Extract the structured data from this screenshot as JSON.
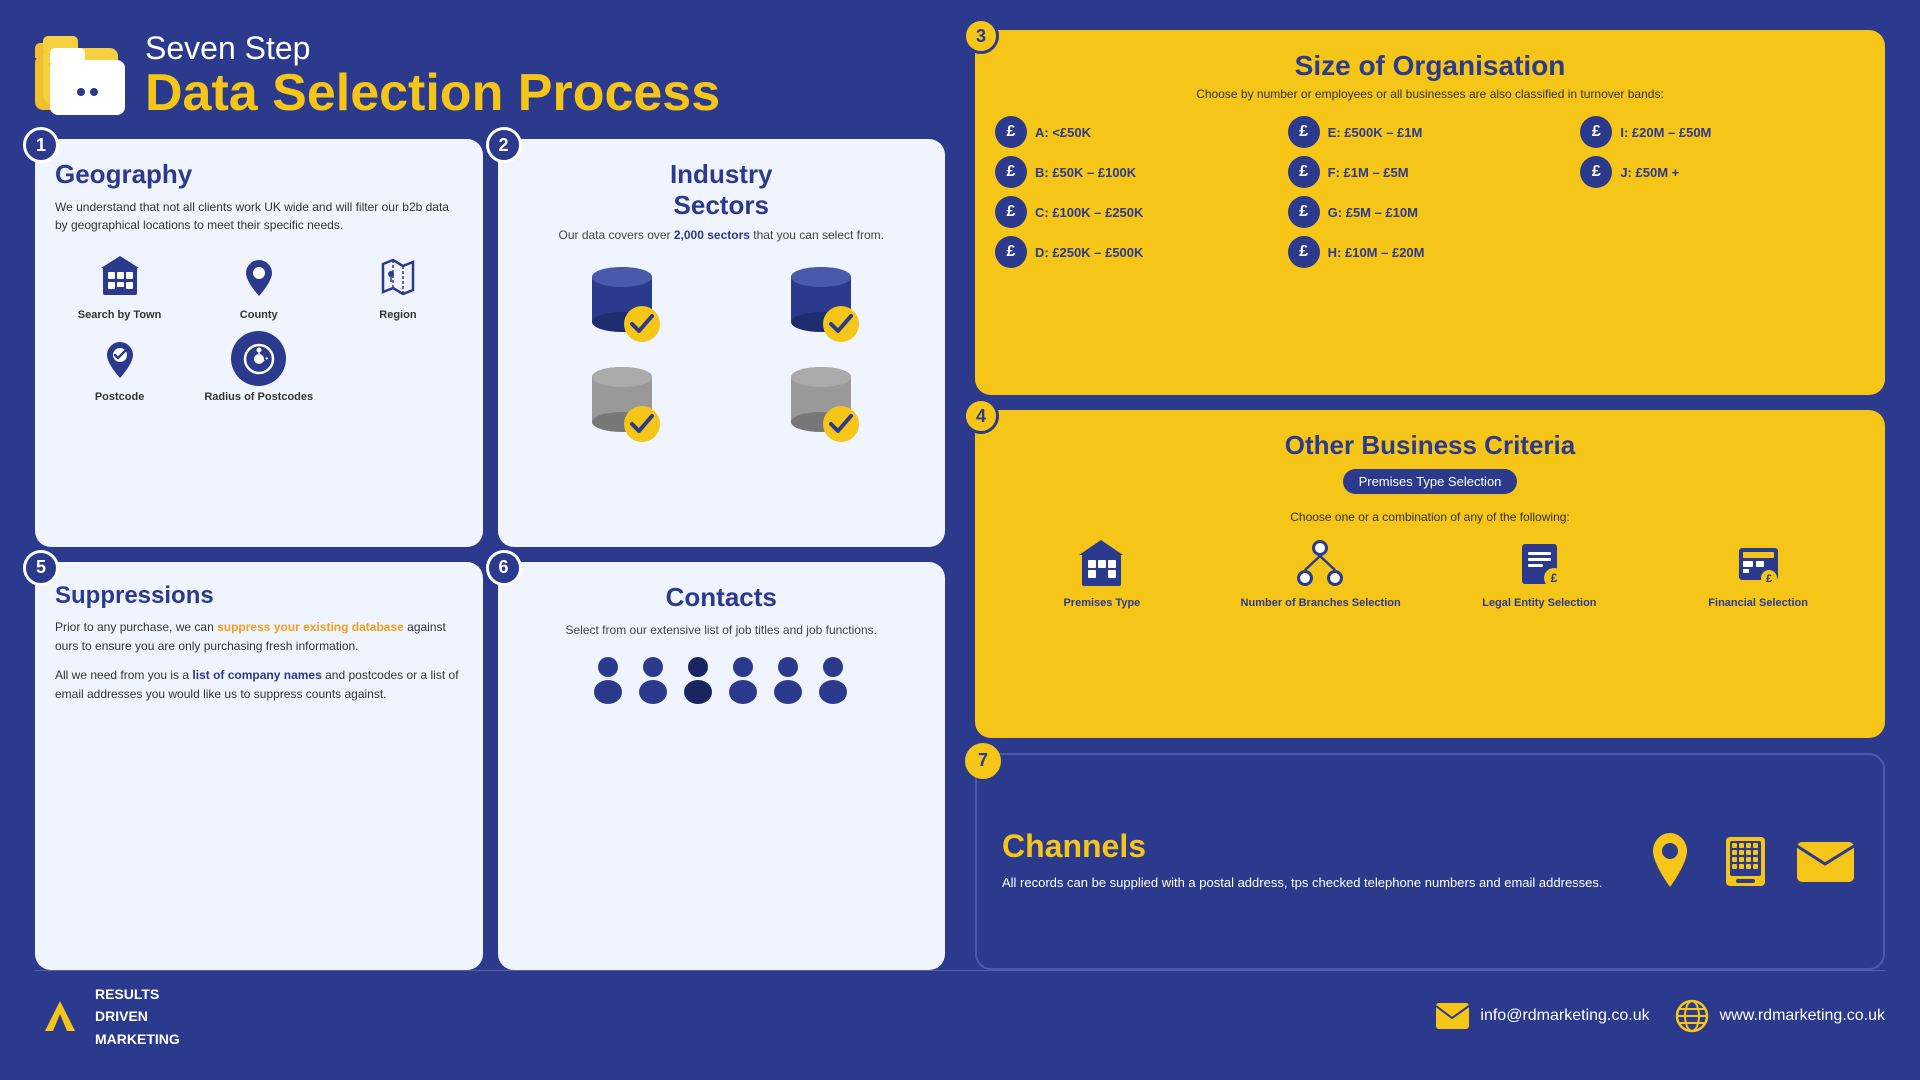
{
  "header": {
    "subtitle": "Seven Step",
    "title": "Data Selection Process",
    "folder_icon": "folder-icon"
  },
  "steps": {
    "step1": {
      "number": "1",
      "title": "Geography",
      "description": "We understand that not all clients work UK wide and will filter our b2b data by geographical locations to meet their specific needs.",
      "items": [
        {
          "label": "Search by Town",
          "icon": "building-icon"
        },
        {
          "label": "County",
          "icon": "map-pin-icon"
        },
        {
          "label": "Region",
          "icon": "map-region-icon"
        },
        {
          "label": "Postcode",
          "icon": "postcode-icon"
        },
        {
          "label": "Radius of Postcodes",
          "icon": "radius-icon"
        }
      ]
    },
    "step2": {
      "number": "2",
      "title": "Industry Sectors",
      "description_prefix": "Our data covers over ",
      "highlight": "2,000 sectors",
      "description_suffix": " that you can select from.",
      "icon": "database-icon"
    },
    "step3": {
      "number": "3",
      "title": "Size of Organisation",
      "description": "Choose by number or employees or all businesses are also classified in turnover bands:",
      "bands": [
        {
          "label": "A: <£50K"
        },
        {
          "label": "B: £50K – £100K"
        },
        {
          "label": "C: £100K – £250K"
        },
        {
          "label": "D: £250K – £500K"
        },
        {
          "label": "E: £500K – £1M"
        },
        {
          "label": "F: £1M – £5M"
        },
        {
          "label": "G: £5M – £10M"
        },
        {
          "label": "H: £10M – £20M"
        },
        {
          "label": "I: £20M – £50M"
        },
        {
          "label": "J: £50M +"
        }
      ]
    },
    "step4": {
      "number": "4",
      "title": "Other Business Criteria",
      "badge": "Premises Type Selection",
      "description": "Choose one or a combination of any of the following:",
      "items": [
        {
          "label": "Premises Type",
          "icon": "building2-icon"
        },
        {
          "label": "Number of Branches Selection",
          "icon": "branches-icon"
        },
        {
          "label": "Legal Entity Selection",
          "icon": "legal-icon"
        },
        {
          "label": "Financial Selection",
          "icon": "financial-icon"
        }
      ]
    },
    "step5": {
      "number": "5",
      "title": "Suppressions",
      "description1": "Prior to any purchase, we can ",
      "highlight1": "suppress your existing database",
      "description1b": " against ours to ensure you are only purchasing fresh information.",
      "description2_prefix": "All we need from you is a ",
      "highlight2": "list of company names",
      "description2_suffix": " and postcodes or a list of email addresses you would like us to suppress counts against."
    },
    "step6": {
      "number": "6",
      "title": "Contacts",
      "description": "Select from our extensive list of job titles and job functions.",
      "icon": "contacts-icon"
    },
    "step7": {
      "number": "7",
      "title": "Channels",
      "description": "All records can be supplied with a postal address, tps checked telephone numbers and email addresses.",
      "icons": [
        "location-icon",
        "phone-icon",
        "email-icon"
      ]
    }
  },
  "footer": {
    "logo_line1": "RESULTS",
    "logo_line2": "DRIVEN",
    "logo_line3": "MARKETING",
    "email": "info@rdmarketing.co.uk",
    "website": "www.rdmarketing.co.uk"
  }
}
